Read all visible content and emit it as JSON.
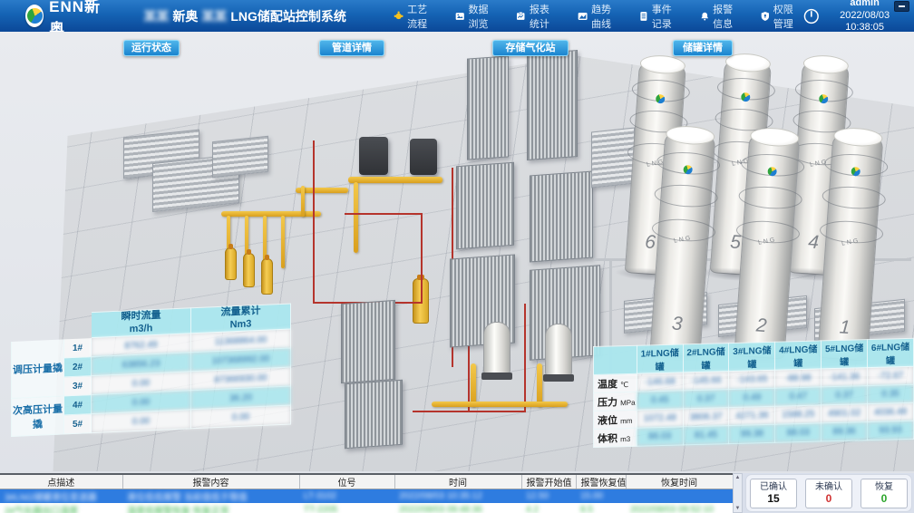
{
  "header": {
    "logo_text": "ENN新奥",
    "title_redacted_1": "某某",
    "title_part_1": "新奥",
    "title_redacted_2": "某某",
    "title_part_2": "LNG储配站控制系统",
    "menu": [
      {
        "label": "工艺流程"
      },
      {
        "label": "数据浏览"
      },
      {
        "label": "报表统计"
      },
      {
        "label": "趋势曲线"
      },
      {
        "label": "事件记录"
      },
      {
        "label": "报警信息"
      },
      {
        "label": "权限管理"
      }
    ],
    "user": "admin",
    "datetime": "2022/08/03 10:38:05"
  },
  "view_buttons": {
    "b1": "运行状态",
    "b2": "管道详情",
    "b3": "存储气化站",
    "b4": "储罐详情"
  },
  "left_table": {
    "flow_header": "瞬时流量",
    "flow_unit": "m3/h",
    "total_header": "流量累计",
    "total_unit": "Nm3",
    "group1": "调压计量撬",
    "group2": "次高压计量撬",
    "rows": [
      {
        "id": "1#",
        "flow": "8762.49",
        "total": "11368864.00"
      },
      {
        "id": "2#",
        "flow": "63856.23",
        "total": "107368992.00"
      },
      {
        "id": "3#",
        "flow": "0.00",
        "total": "87366930.00"
      },
      {
        "id": "4#",
        "flow": "0.00",
        "total": "36.20"
      },
      {
        "id": "5#",
        "flow": "0.00",
        "total": "0.00"
      }
    ]
  },
  "tank_table": {
    "columns": [
      "1#LNG储罐",
      "2#LNG储罐",
      "3#LNG储罐",
      "4#LNG储罐",
      "5#LNG储罐",
      "6#LNG储罐"
    ],
    "rows": [
      {
        "label": "温度",
        "unit": "℃",
        "values": [
          "-146.68",
          "-145.66",
          "-143.65",
          "-88.98",
          "-141.36",
          "-72.67"
        ]
      },
      {
        "label": "压力",
        "unit": "MPa",
        "values": [
          "0.45",
          "0.37",
          "0.49",
          "0.47",
          "0.37",
          "0.35"
        ]
      },
      {
        "label": "液位",
        "unit": "mm",
        "values": [
          "1072.48",
          "3806.37",
          "4271.36",
          "1588.25",
          "4901.02",
          "4036.48"
        ]
      },
      {
        "label": "体积",
        "unit": "m3",
        "values": [
          "86.03",
          "81.45",
          "99.38",
          "88.03",
          "89.36",
          "93.93"
        ]
      }
    ]
  },
  "alarm_table": {
    "headers": [
      "点描述",
      "报警内容",
      "位号",
      "时间",
      "报警开始值",
      "报警恢复值",
      "恢复时间"
    ],
    "rows": [
      {
        "desc": "3#LNG储罐液位变送器",
        "content": "液位低低报警 当前值低于限值",
        "tag": "LT-3102",
        "time": "2022/08/03 10:35:12",
        "start": "12.50",
        "recover": "15.00",
        "rtime": ""
      },
      {
        "desc": "2#气化器出口温度",
        "content": "温度低报警恢复 恢复正常",
        "tag": "TT-2205",
        "time": "2022/08/03 09:48:36",
        "start": "4.2",
        "recover": "8.5",
        "rtime": "2022/08/03 09:52:10"
      }
    ]
  },
  "alarm_summary": {
    "confirmed_label": "已确认",
    "confirmed_value": "15",
    "unconfirmed_label": "未确认",
    "unconfirmed_value": "0",
    "recovered_label": "恢复",
    "recovered_value": "0"
  },
  "scene": {
    "tank_label": "LNG",
    "tanks": [
      {
        "num": "6"
      },
      {
        "num": "5"
      },
      {
        "num": "4"
      },
      {
        "num": "3"
      },
      {
        "num": "2"
      },
      {
        "num": "1"
      }
    ]
  },
  "colors": {
    "accent": "#1b84cf",
    "header_top": "#2a7bc9",
    "header_bottom": "#0b4898",
    "selected_row": "#2e7ce0",
    "table_cyan": "#ace8f0",
    "ok_green": "#2ba52b",
    "alert_red": "#d03030"
  }
}
